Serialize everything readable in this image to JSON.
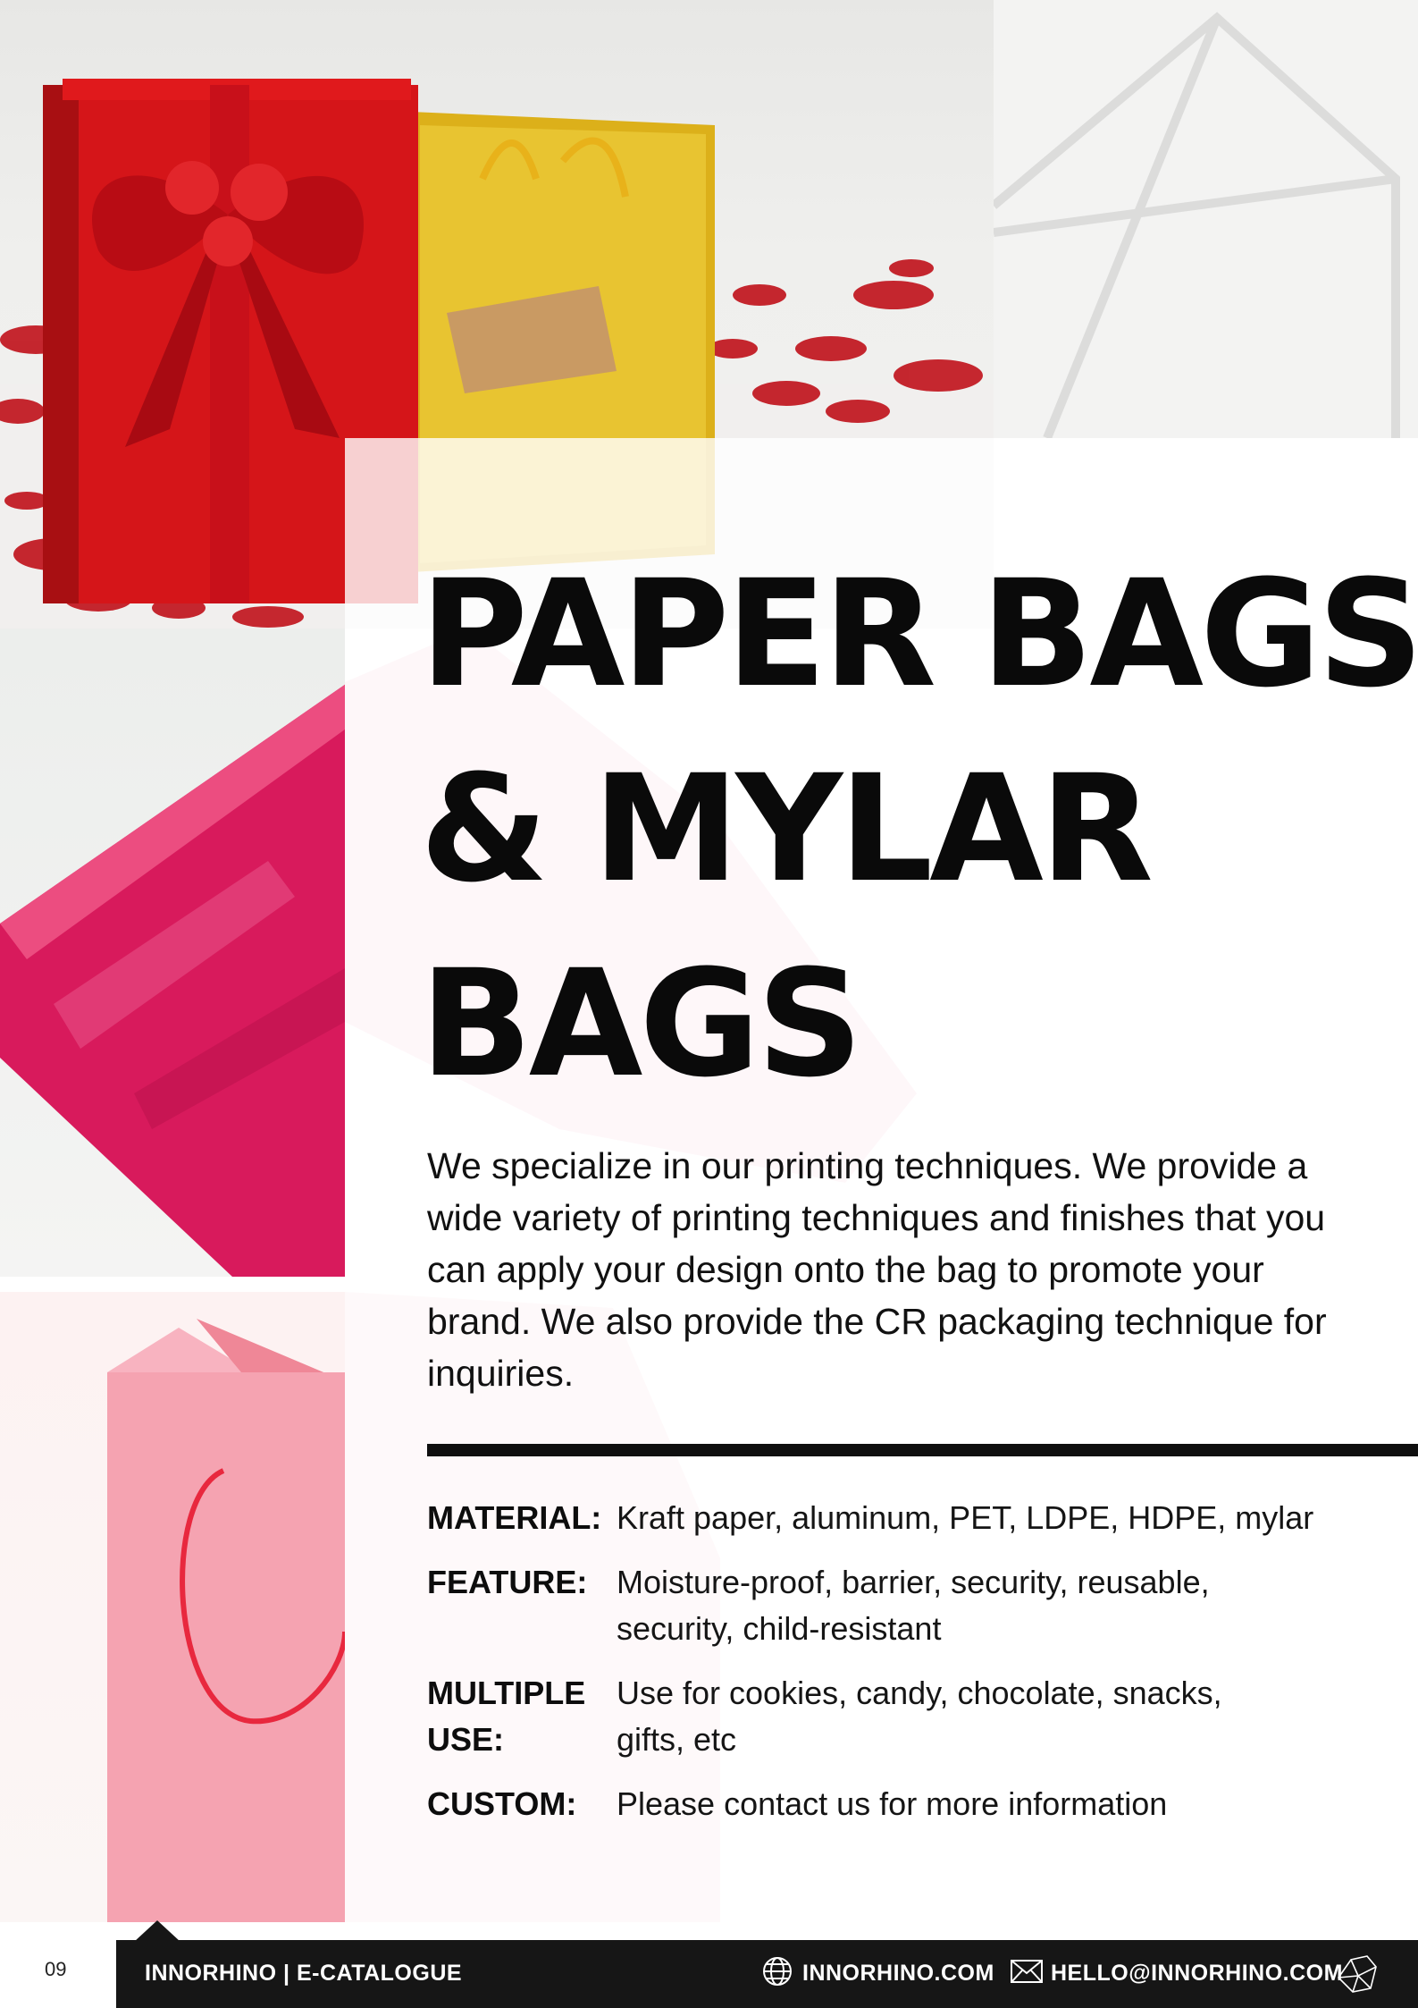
{
  "title_lines": [
    "PAPER BAGS",
    "& MYLAR",
    "BAGS"
  ],
  "intro": "We specialize in our printing techniques. We provide a wide variety of printing techniques and finishes that you can apply your design onto the bag to promote your brand. We also provide the CR packaging technique for inquiries.",
  "specs": [
    {
      "label": "MATERIAL:",
      "value": "Kraft paper, aluminum, PET, LDPE, HDPE, mylar"
    },
    {
      "label": "FEATURE:",
      "value": "Moisture-proof, barrier, security, reusable, security, child-resistant"
    },
    {
      "label": "MULTIPLE USE:",
      "value": "Use for cookies, candy, chocolate, snacks, gifts, etc"
    },
    {
      "label": "CUSTOM:",
      "value": "Please contact us for more information"
    }
  ],
  "footer": {
    "page_number": "09",
    "brand": "INNORHINO | E-CATALOGUE",
    "website": "INNORHINO.COM",
    "email": "HELLO@INNORHINO.COM"
  },
  "icons": [
    "globe-icon",
    "mail-icon",
    "rhino-logo-icon"
  ],
  "colors": {
    "footer_bar": "#161616",
    "accent_red": "#d4141c",
    "gold": "#e0b21a",
    "magenta": "#d8155c",
    "pink": "#f7a7b6"
  }
}
